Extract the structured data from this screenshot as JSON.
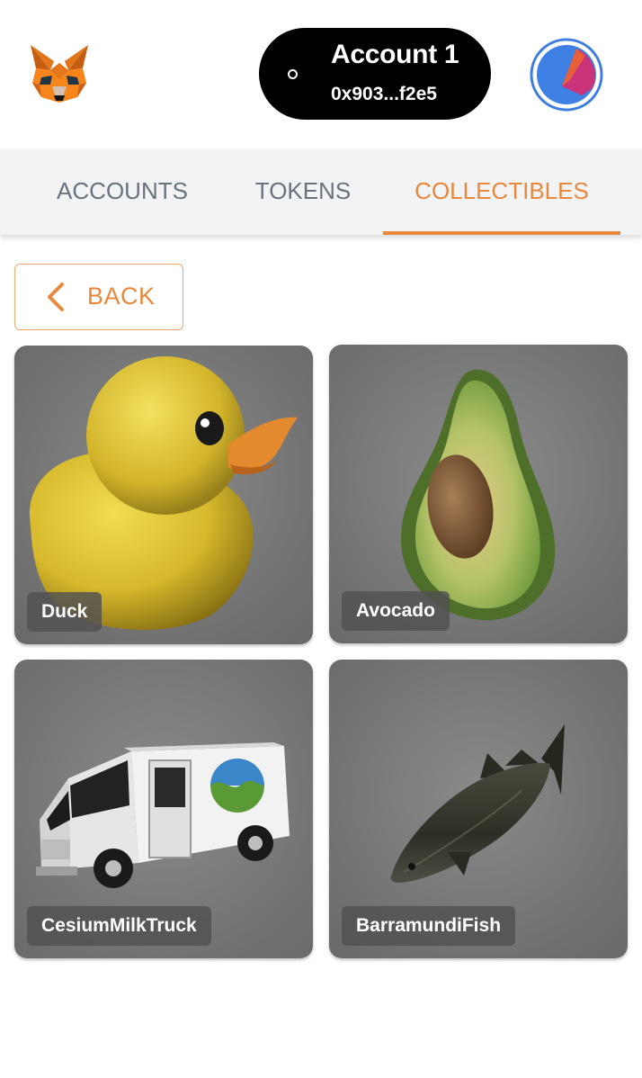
{
  "header": {
    "logo_icon": "metamask-fox-icon",
    "account": {
      "name": "Account 1",
      "address": "0x903...f2e5"
    },
    "avatar_icon": "identicon-avatar"
  },
  "tabs": [
    {
      "label": "ACCOUNTS",
      "active": false
    },
    {
      "label": "TOKENS",
      "active": false
    },
    {
      "label": "COLLECTIBLES",
      "active": true
    }
  ],
  "back_button": {
    "label": "BACK"
  },
  "collectibles": [
    {
      "name": "Duck"
    },
    {
      "name": "Avocado"
    },
    {
      "name": "CesiumMilkTruck"
    },
    {
      "name": "BarramundiFish"
    }
  ],
  "colors": {
    "accent": "#e8883c",
    "tab_text": "#6a737d",
    "tab_bar": "#f2f3f4",
    "pill": "#000000"
  }
}
